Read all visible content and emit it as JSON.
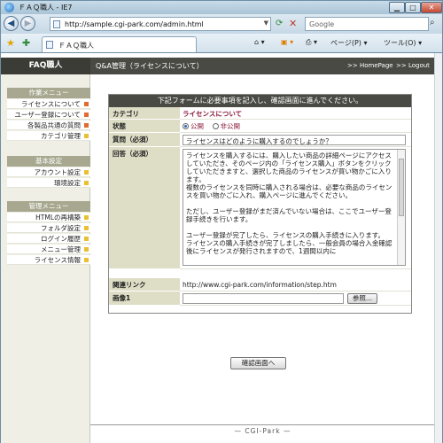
{
  "window": {
    "title": "ＦＡＱ職人 - IE7",
    "min_label": "▁",
    "max_label": "□",
    "close_label": "✕"
  },
  "addressbar": {
    "url": "http://sample.cgi-park.com/admin.html",
    "search_placeholder": "Google"
  },
  "tabbar": {
    "tab_title": "ＦＡＱ職人",
    "page_menu": "ページ(P) ▾",
    "tools_menu": "ツール(O) ▾"
  },
  "site": {
    "title": "FAQ職人",
    "page_title": "Q&A管理（ライセンスについて）",
    "homepage_link": ">> HomePage",
    "logout_link": ">> Logout",
    "footer": "— CGI-Park —"
  },
  "sidebar": {
    "sections": [
      {
        "heading": "作業メニュー",
        "items": [
          {
            "label": "ライセンスについて",
            "mark_color": "#e06a30"
          },
          {
            "label": "ユーザー登録について",
            "mark_color": "#e06a30"
          },
          {
            "label": "各製品共通の質問",
            "mark_color": "#e06a30"
          },
          {
            "label": "カテゴリ管理",
            "mark_color": "#e8c030"
          }
        ]
      },
      {
        "heading": "基本設定",
        "items": [
          {
            "label": "アカウント設定",
            "mark_color": "#e8c030"
          },
          {
            "label": "環境設定",
            "mark_color": "#e8c030"
          }
        ]
      },
      {
        "heading": "管理メニュー",
        "items": [
          {
            "label": "HTMLの再構築",
            "mark_color": "#e8c030"
          },
          {
            "label": "フォルダ設定",
            "mark_color": "#e8c030"
          },
          {
            "label": "ログイン履歴",
            "mark_color": "#e8c030"
          },
          {
            "label": "メニュー管理",
            "mark_color": "#e8c030"
          },
          {
            "label": "ライセンス情報",
            "mark_color": "#e8c030"
          }
        ]
      }
    ]
  },
  "form": {
    "heading": "下記フォームに必要事項を記入し、確認画面に進んでください。",
    "category_label": "カテゴリ",
    "category_value": "ライセンスについて",
    "status_label": "状態",
    "status_public": "公開",
    "status_private": "非公開",
    "status_selected": "公開",
    "question_label": "質問（必須）",
    "question_value": "ライセンスはどのように購入するのでしょうか？",
    "answer_label": "回答（必須）",
    "answer_value": "ライセンスを購入するには、購入したい商品の詳細ページにアクセスしていただき、そのページ内の「ライセンス購入」ボタンをクリックしていただきますと、選択した商品のライセンスが買い物かごに入ります。\n複数のライセンスを同時に購入される場合は、必要な商品のライセンスを買い物かごに入れ、購入ページに進んでください。\n\nただし、ユーザー登録がまだ済んでいない場合は、ここでユーザー登録手続きを行います。\n\nユーザー登録が完了したら、ライセンスの購入手続きに入ります。\nライセンスの購入手続きが完了しましたら、一般会員の場合入金確認後にライセンスが発行されますので、1週間以内に",
    "related_label": "関連リンク",
    "related_value": "http://www.cgi-park.com/information/step.htm",
    "image_label": "画像1",
    "browse_label": "参照...",
    "confirm_label": "確認画面へ"
  }
}
